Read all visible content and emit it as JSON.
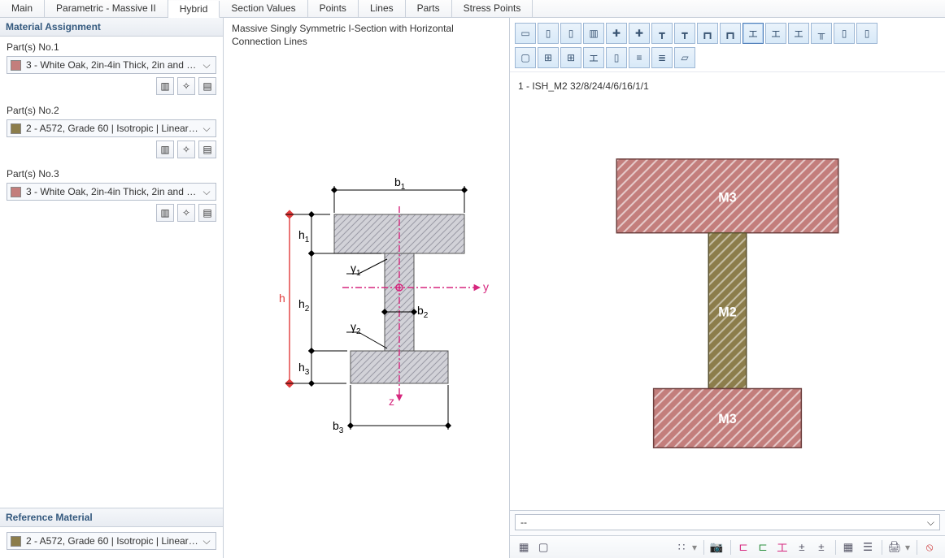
{
  "tabs": [
    "Main",
    "Parametric - Massive II",
    "Hybrid",
    "Section Values",
    "Points",
    "Lines",
    "Parts",
    "Stress Points"
  ],
  "active_tab": 2,
  "left": {
    "panel_title": "Material Assignment",
    "parts": [
      {
        "label": "Part(s) No.1",
        "swatch": "red",
        "material": "3 - White Oak, 2in-4in Thick, 2in and W..."
      },
      {
        "label": "Part(s) No.2",
        "swatch": "olive",
        "material": "2 - A572, Grade 60 | Isotropic | Linear El..."
      },
      {
        "label": "Part(s) No.3",
        "swatch": "red",
        "material": "3 - White Oak, 2in-4in Thick, 2in and W..."
      }
    ],
    "ref_panel_title": "Reference Material",
    "ref_material": {
      "swatch": "olive",
      "material": "2 - A572, Grade 60 | Isotropic | Linear El..."
    }
  },
  "mid": {
    "title": "Massive Singly Symmetric I-Section with Horizontal Connection Lines",
    "dims": {
      "h": "h",
      "h1": "h",
      "h2": "h",
      "h3": "h",
      "b1": "b",
      "b2": "b",
      "b3": "b",
      "g1": "γ",
      "g2": "γ",
      "y": "y",
      "z": "z"
    },
    "dim_sub": {
      "h1": "1",
      "h2": "2",
      "h3": "3",
      "b1": "1",
      "b2": "2",
      "b3": "3",
      "g1": "1",
      "g2": "2"
    }
  },
  "right": {
    "section_name": "1 - ISH_M2 32/8/24/4/6/16/1/1",
    "labels": {
      "m2": "M2",
      "m3": "M3"
    },
    "footer_value": "--",
    "colors": {
      "web": "#8c7d4b",
      "flange": "#c37e7c"
    }
  }
}
